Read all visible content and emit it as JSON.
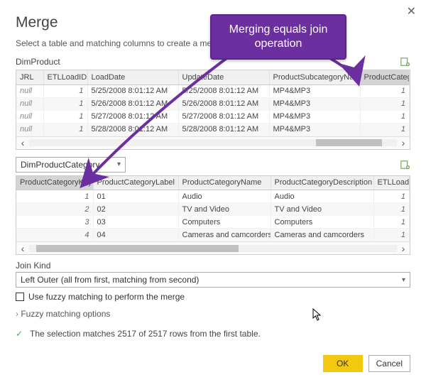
{
  "dialog": {
    "title": "Merge",
    "subtitle": "Select a table and matching columns to create a merged table."
  },
  "callout": {
    "text": "Merging equals join operation"
  },
  "table1": {
    "name": "DimProduct",
    "headers": [
      "JRL",
      "ETLLoadID",
      "LoadDate",
      "UpdateDate",
      "ProductSubcategoryName",
      "ProductCategoryKey"
    ],
    "rows": [
      {
        "jrl": "null",
        "etl": "1",
        "load": "5/25/2008 8:01:12 AM",
        "update": "5/25/2008 8:01:12 AM",
        "subcat": "MP4&MP3",
        "catkey": "1"
      },
      {
        "jrl": "null",
        "etl": "1",
        "load": "5/26/2008 8:01:12 AM",
        "update": "5/26/2008 8:01:12 AM",
        "subcat": "MP4&MP3",
        "catkey": "1"
      },
      {
        "jrl": "null",
        "etl": "1",
        "load": "5/27/2008 8:01:12 AM",
        "update": "5/27/2008 8:01:12 AM",
        "subcat": "MP4&MP3",
        "catkey": "1"
      },
      {
        "jrl": "null",
        "etl": "1",
        "load": "5/28/2008 8:01:12 AM",
        "update": "5/28/2008 8:01:12 AM",
        "subcat": "MP4&MP3",
        "catkey": "1"
      }
    ]
  },
  "table2_dropdown": "DimProductCategory",
  "table2": {
    "headers": [
      "ProductCategoryKey",
      "ProductCategoryLabel",
      "ProductCategoryName",
      "ProductCategoryDescription",
      "ETLLoadID"
    ],
    "rows": [
      {
        "key": "1",
        "label": "01",
        "name": "Audio",
        "desc": "Audio",
        "etl": "1"
      },
      {
        "key": "2",
        "label": "02",
        "name": "TV and Video",
        "desc": "TV and Video",
        "etl": "1"
      },
      {
        "key": "3",
        "label": "03",
        "name": "Computers",
        "desc": "Computers",
        "etl": "1"
      },
      {
        "key": "4",
        "label": "04",
        "name": "Cameras and camcorders",
        "desc": "Cameras and camcorders",
        "etl": "1"
      }
    ]
  },
  "join": {
    "label": "Join Kind",
    "selected": "Left Outer (all from first, matching from second)"
  },
  "fuzzy": {
    "checkbox_label": "Use fuzzy matching to perform the merge",
    "expander_label": "Fuzzy matching options"
  },
  "status": "The selection matches 2517 of 2517 rows from the first table.",
  "buttons": {
    "ok": "OK",
    "cancel": "Cancel"
  },
  "chart_data": null
}
